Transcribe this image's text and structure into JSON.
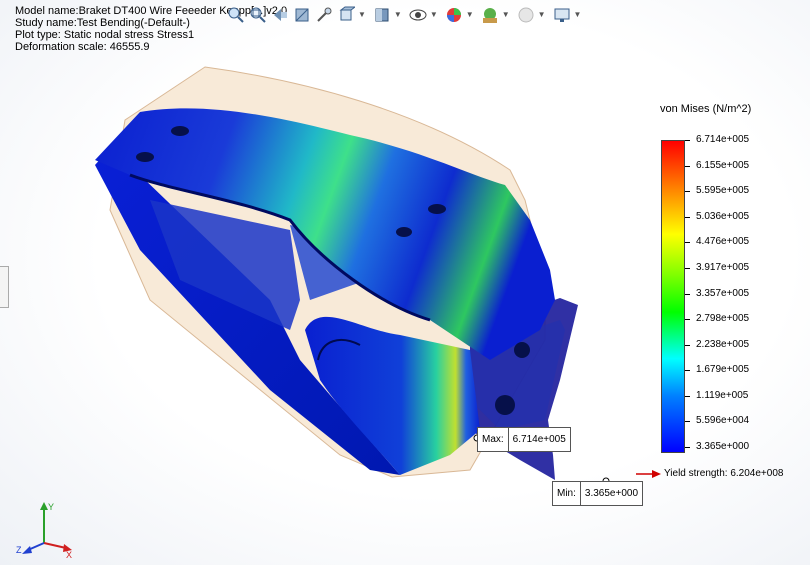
{
  "info": {
    "model_name": "Model name:Braket DT400 Wire Feeeder Keppp[...]v2 0",
    "study_name": "Study name:Test Bending(-Default-)",
    "plot_type": "Plot type: Static nodal stress Stress1",
    "deformation_scale": "Deformation scale: 46555.9"
  },
  "toolbar": {
    "icons": [
      "zoom-to-fit-icon",
      "zoom-to-area-icon",
      "previous-view-icon",
      "section-view-icon",
      "dynamic-annotation-icon",
      "view-orientation-icon",
      "display-style-icon",
      "hide-show-icon",
      "edit-appearance-icon",
      "apply-scene-icon",
      "view-settings-icon",
      "display-icon"
    ]
  },
  "legend": {
    "title": "von Mises (N/m^2)",
    "ticks": [
      "6.714e+005",
      "6.155e+005",
      "5.595e+005",
      "5.036e+005",
      "4.476e+005",
      "3.917e+005",
      "3.357e+005",
      "2.798e+005",
      "2.238e+005",
      "1.679e+005",
      "1.119e+005",
      "5.596e+004",
      "3.365e+000"
    ],
    "yield_strength": "Yield strength: 6.204e+008",
    "colors": {
      "max": "#ff0000",
      "min": "#0000ff",
      "yield_arrow": "#d00000"
    }
  },
  "callouts": {
    "max_label": "Max:",
    "max_value": "6.714e+005",
    "min_label": "Min:",
    "min_value": "3.365e+000"
  },
  "triad": {
    "x": "X",
    "y": "Y",
    "z": "Z"
  }
}
